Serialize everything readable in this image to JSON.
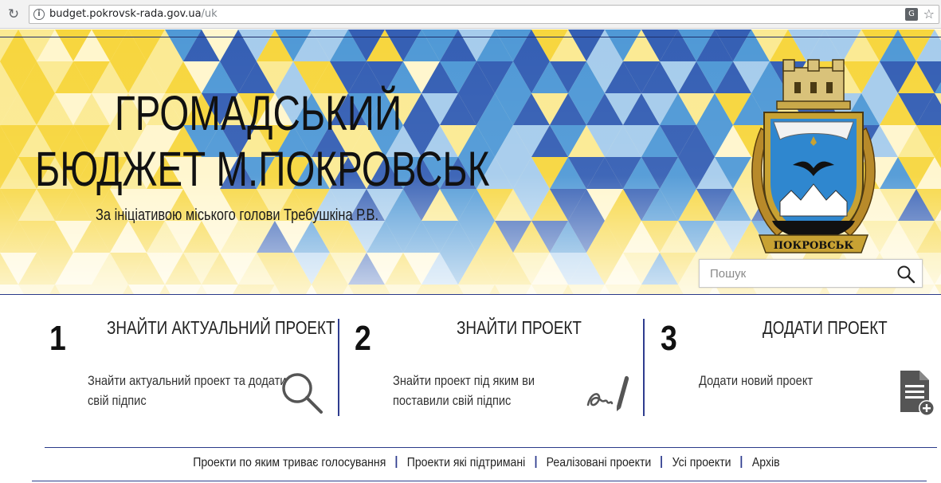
{
  "browser": {
    "url_host": "budget.pokrovsk-rada.gov.ua",
    "url_path": "/uk",
    "translate_icon": "translate-icon",
    "bookmark_icon": "star-icon"
  },
  "banner": {
    "title_line1": "ГРОМАДСЬКИЙ",
    "title_line2": "БЮДЖЕТ М.ПОКРОВСЬК",
    "subtitle": "За ініціативою міського голови Требушкіна Р.В.",
    "emblem_ribbon_text": "ПОКРОВСЬК",
    "colors": {
      "yellow": "#f6d32d",
      "blue": "#3d8fd6",
      "deep_blue": "#1f4fb0",
      "light_blue": "#9cc8ee"
    }
  },
  "search": {
    "placeholder": "Пошук",
    "icon": "search-icon"
  },
  "steps": [
    {
      "number": "1",
      "title": "ЗНАЙТИ АКТУАЛЬНИЙ ПРОЕКТ",
      "desc_line1": "Знайти актуальний проект та додати",
      "desc_line2": "свій підпис",
      "icon": "magnifier-icon"
    },
    {
      "number": "2",
      "title": "ЗНАЙТИ ПРОЕКТ",
      "desc_line1": "Знайти проект під яким ви",
      "desc_line2": "поставили свій підпис",
      "icon": "signature-icon"
    },
    {
      "number": "3",
      "title": "ДОДАТИ ПРОЕКТ",
      "desc_line1": "Додати новий проект",
      "desc_line2": "",
      "icon": "add-document-icon"
    }
  ],
  "nav": [
    "Проекти по яким триває голосування",
    "Проекти які підтримані",
    "Реалізовані проекти",
    "Усі проекти",
    "Архів"
  ],
  "accent_color": "#2f3d8f"
}
